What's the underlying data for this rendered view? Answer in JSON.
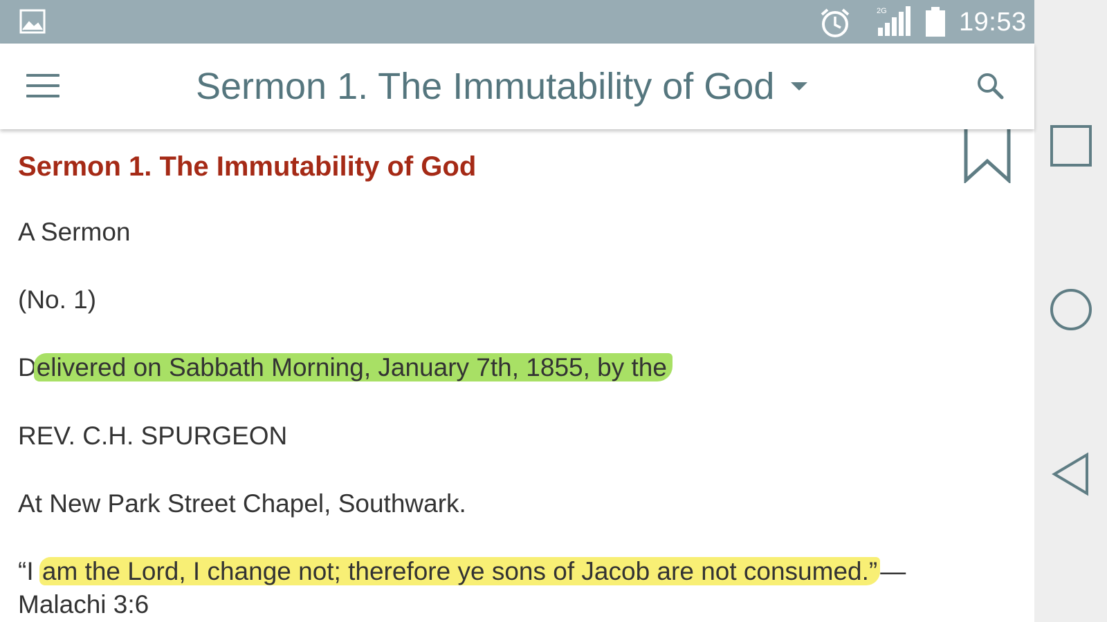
{
  "status_bar": {
    "time": "19:53",
    "network_label": "2G",
    "icons": [
      "gallery-icon",
      "alarm-icon",
      "signal-icon",
      "battery-icon"
    ]
  },
  "app_bar": {
    "title": "Sermon 1. The Immutability of God",
    "icons": [
      "menu-icon",
      "dropdown-arrow-icon",
      "search-icon"
    ]
  },
  "document": {
    "title": "Sermon 1. The Immutability of God",
    "paragraphs": {
      "line1": "A Sermon",
      "line2": "(No. 1)",
      "line3_pre": "D",
      "line3_highlight": "elivered on Sabbath Morning, January 7th, 1855, by the",
      "line4": "REV. C.H. SPURGEON",
      "line5": "At New Park Street Chapel, Southwark.",
      "line6_pre": "“I ",
      "line6_highlight": "am the Lord, I change not; therefore ye sons of Jacob are not consumed.”",
      "line6_post": "—",
      "line7": "Malachi 3:6"
    },
    "highlight_colors": {
      "green": "#a8e065",
      "yellow": "#f8ef75"
    },
    "title_color": "#a52a16"
  },
  "nav_bar": {
    "icons": [
      "recents-square-icon",
      "home-circle-icon",
      "back-triangle-icon"
    ]
  },
  "colors": {
    "status_bar": "#98acb4",
    "app_bar_text": "#55767e",
    "nav_bar": "#eeeeee"
  }
}
